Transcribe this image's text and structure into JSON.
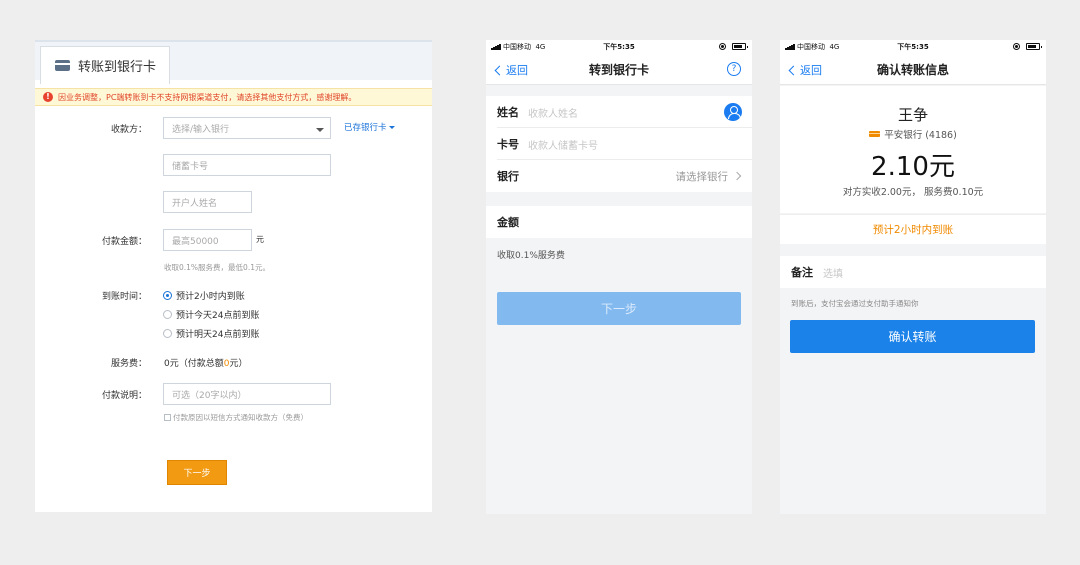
{
  "pc": {
    "tab_title": "转账到银行卡",
    "notice": "因业务调整，PC端转账到卡不支持网银渠道支付，请选择其他支付方式，感谢理解。",
    "payee_label": "收款方：",
    "bank_placeholder": "选择/输入银行",
    "saved_cards": "已存银行卡",
    "card_placeholder": "储蓄卡号",
    "name_placeholder": "开户人姓名",
    "amount_label": "付款金额：",
    "amount_placeholder": "最高50000",
    "amount_unit": "元",
    "fee_hint": "收取0.1%服务费，最低0.1元。",
    "arrival_label": "到账时间：",
    "arrival_options": [
      "预计2小时内到账",
      "预计今天24点前到账",
      "预计明天24点前到账"
    ],
    "service_fee_label": "服务费：",
    "service_fee_prefix": "0元（付款总额",
    "service_fee_total": "0",
    "service_fee_suffix": "元）",
    "note_label": "付款说明：",
    "note_placeholder": "可选（20字以内）",
    "sms_notify": "付款原因以短信方式通知收款方（免费）",
    "next_button": "下一步"
  },
  "status_bar": {
    "carrier": "中国移动",
    "network": "4G",
    "time": "下午5:35"
  },
  "transfer_screen": {
    "back": "返回",
    "title": "转到银行卡",
    "help_icon": "?",
    "name_label": "姓名",
    "name_placeholder": "收款人姓名",
    "card_label": "卡号",
    "card_placeholder": "收款人储蓄卡号",
    "bank_label": "银行",
    "bank_placeholder": "请选择银行",
    "amount_label": "金额",
    "fee_text": "收取0.1%服务费",
    "next_button": "下一步"
  },
  "confirm_screen": {
    "back": "返回",
    "title": "确认转账信息",
    "payee_name": "王争",
    "payee_bank": "平安银行 (4186)",
    "amount": "2.10元",
    "amount_detail": "对方实收2.00元，  服务费0.10元",
    "eta": "预计2小时内到账",
    "remark_label": "备注",
    "remark_placeholder": "选填",
    "notify_text": "到账后，支付宝会通过支付助手通知你",
    "confirm_button": "确认转账"
  },
  "colors": {
    "accent_blue": "#1a82e8",
    "accent_orange": "#f08a00",
    "disabled_blue": "#82b9ef",
    "warning_red": "#e8432e"
  }
}
